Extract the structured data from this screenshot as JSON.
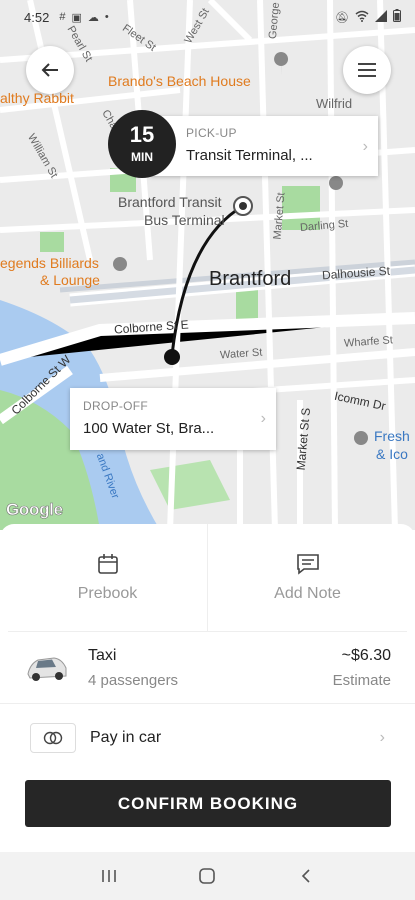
{
  "status_bar": {
    "time": "4:52",
    "left_icons": [
      "hashtag-icon",
      "image-icon",
      "cloud-icon",
      "dot-icon"
    ],
    "right_icons": [
      "mute-icon",
      "wifi-icon",
      "signal-icon",
      "battery-icon"
    ]
  },
  "map": {
    "labels": {
      "pearl": "Pearl St",
      "fleet": "Fleet St",
      "west": "West St",
      "george": "George St",
      "chatham": "Chatham St",
      "william": "William St",
      "market": "Market St",
      "market2": "Market St S",
      "darling": "Darling St",
      "dalhousie": "Dalhousie St",
      "colborne": "Colborne St E",
      "colborne_w": "Colborne St W",
      "water": "Water St",
      "wharfe": "Wharfe St",
      "icomm": "Icomm Dr",
      "wilfrid": "Wilfrid",
      "brandos": "Brando's Beach House",
      "rabbit": "althy Rabbit",
      "billiards_1": "egends Billiards",
      "billiards_2": "& Lounge",
      "terminal_1": "Brantford Transit",
      "terminal_2": "Bus Terminal",
      "city": "Brantford",
      "fresh_1": "Fresh",
      "fresh_2": "& Ico",
      "river": "and River",
      "google": "Google"
    },
    "pickup": {
      "eta_number": "15",
      "eta_unit": "MIN",
      "caption": "PICK-UP",
      "value": "Transit Terminal, ..."
    },
    "dropoff": {
      "caption": "DROP-OFF",
      "value": "100 Water St, Bra..."
    }
  },
  "actions": {
    "prebook": "Prebook",
    "add_note": "Add Note"
  },
  "vehicle": {
    "name": "Taxi",
    "passengers": "4 passengers",
    "price": "~$6.30",
    "price_note": "Estimate"
  },
  "payment": {
    "label": "Pay in car"
  },
  "confirm_label": "CONFIRM BOOKING",
  "colors": {
    "primary_button": "#262626",
    "map_background": "#ebebeb",
    "water": "#aacbf0",
    "park": "#a8dba0",
    "poi": "#e07b1f"
  }
}
